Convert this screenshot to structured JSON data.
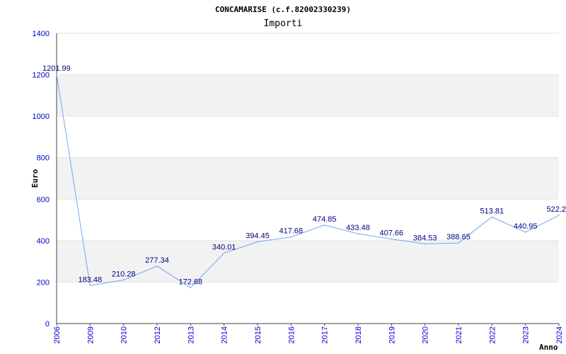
{
  "chart_data": {
    "type": "line",
    "title": "CONCAMARISE (c.f.82002330239)",
    "subtitle": "Importi",
    "xlabel": "Anno",
    "ylabel": "Euro",
    "categories": [
      "2006",
      "2009",
      "2010",
      "2012",
      "2013",
      "2014",
      "2015",
      "2016",
      "2017",
      "2018",
      "2019",
      "2020",
      "2021",
      "2022",
      "2023",
      "2024"
    ],
    "series": [
      {
        "values": [
          1201.99,
          183.48,
          210.28,
          277.34,
          172.68,
          340.01,
          394.45,
          417.68,
          474.85,
          433.48,
          407.66,
          384.53,
          388.65,
          513.81,
          440.95,
          522.2
        ],
        "data_labels": [
          "1201.99",
          "183.48",
          "210.28",
          "277.34",
          "172.68",
          "340.01",
          "394.45",
          "417.68",
          "474.85",
          "433.48",
          "407.66",
          "384.53",
          "388.65",
          "513.81",
          "440.95",
          "522.2"
        ]
      }
    ],
    "ylim": [
      0,
      1400
    ],
    "yticks": [
      "0",
      "200",
      "400",
      "600",
      "800",
      "1000",
      "1200",
      "1400"
    ],
    "grid": true,
    "colors": {
      "line": "#6fa8ee",
      "band": "#f2f2f2",
      "tick_text": "#0000cc",
      "data_label_text": "#000080"
    }
  }
}
